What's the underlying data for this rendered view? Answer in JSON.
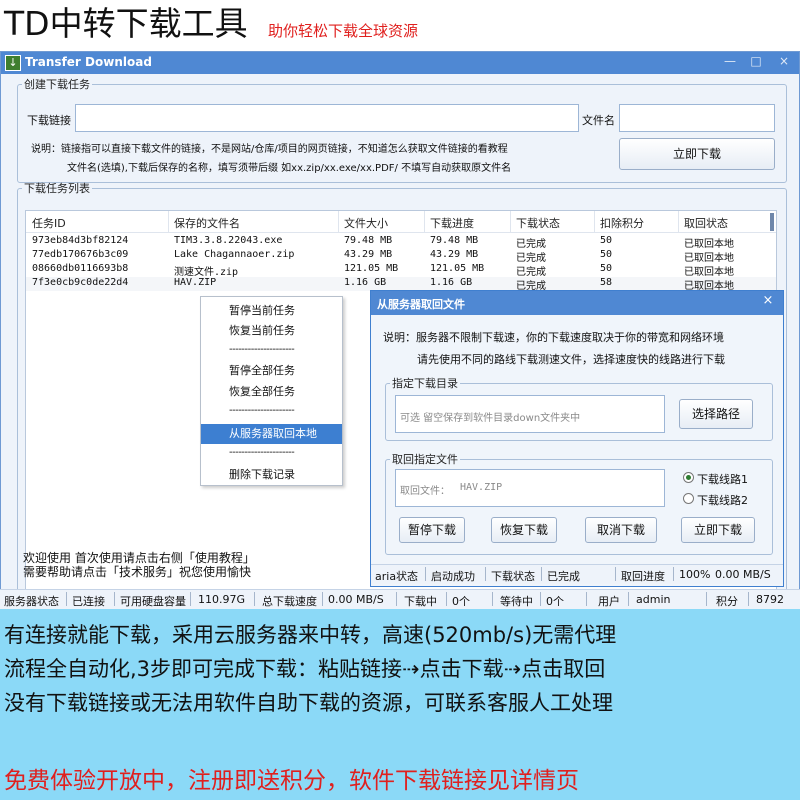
{
  "banner": {
    "title": "TD中转下载工具",
    "subtitle": "助你轻松下载全球资源"
  },
  "window": {
    "title": "Transfer Download",
    "controls": [
      "—",
      "□",
      "×"
    ]
  },
  "create_task": {
    "legend": "创建下载任务",
    "link_label": "下载链接",
    "link_value": "",
    "filename_label": "文件名",
    "filename_value": "",
    "note_line1": "说明：链接指可以直接下载文件的链接，不是网站/仓库/项目的网页链接，不知道怎么获取文件链接的看教程",
    "note_line2": "文件名(选填),下载后保存的名称，填写须带后缀 如xx.zip/xx.exe/xx.PDF/ 不填写自动获取原文件名",
    "download_button": "立即下载"
  },
  "task_list": {
    "legend": "下载任务列表",
    "columns": [
      "任务ID",
      "保存的文件名",
      "文件大小",
      "下载进度",
      "下载状态",
      "扣除积分",
      "取回状态"
    ],
    "rows": [
      [
        "973eb84d3bf82124",
        "TIM3.3.8.22043.exe",
        "79.48 MB",
        "79.48 MB",
        "已完成",
        "50",
        "已取回本地"
      ],
      [
        "77edb170676b3c09",
        "Lake Chagannaoer.zip",
        "43.29 MB",
        "43.29 MB",
        "已完成",
        "50",
        "已取回本地"
      ],
      [
        "08660db0116693b8",
        "测速文件.zip",
        "121.05 MB",
        "121.05 MB",
        "已完成",
        "50",
        "已取回本地"
      ],
      [
        "7f3e0cb9c0de22d4",
        "HAV.ZIP",
        "1.16 GB",
        "1.16 GB",
        "已完成",
        "58",
        "已取回本地"
      ]
    ],
    "welcome_line1": "欢迎使用 首次使用请点击右侧「使用教程」",
    "welcome_line2": "需要帮助请点击「技术服务」祝您使用愉快"
  },
  "context_menu": {
    "items": [
      "暂停当前任务",
      "恢复当前任务",
      "---------------------",
      "暂停全部任务",
      "恢复全部任务",
      "---------------------",
      "从服务器取回本地",
      "---------------------",
      "删除下载记录"
    ]
  },
  "dialog": {
    "title": "从服务器取回文件",
    "note_line1": "说明：服务器不限制下载速，你的下载速度取决于你的带宽和网络环境",
    "note_line2": "请先使用不同的路线下载测速文件，选择速度快的线路进行下载",
    "dir_legend": "指定下载目录",
    "dir_placeholder": "可选 留空保存到软件目录down文件夹中",
    "choose_path_button": "选择路径",
    "file_legend": "取回指定文件",
    "file_label": "取回文件：",
    "file_value": "HAV.ZIP",
    "route1": "下载线路1",
    "route2": "下载线路2",
    "buttons": [
      "暂停下载",
      "恢复下载",
      "取消下载",
      "立即下载"
    ],
    "status": {
      "aria_label": "aria状态",
      "aria_value": "启动成功",
      "dl_label": "下载状态",
      "dl_value": "已完成",
      "progress_label": "取回进度",
      "progress_value": "100%",
      "speed_value": "0.00 MB/S"
    }
  },
  "statusbar": {
    "server_label": "服务器状态",
    "server_value": "已连接",
    "disk_label": "可用硬盘容量",
    "disk_value": "110.97G",
    "speed_label": "总下载速度",
    "speed_value": "0.00 MB/S",
    "downloading_label": "下载中",
    "downloading_value": "0个",
    "waiting_label": "等待中",
    "waiting_value": "0个",
    "user_label": "用户",
    "user_value": "admin",
    "points_label": "积分",
    "points_value": "8792"
  },
  "promo": {
    "line1": "有连接就能下载，采用云服务器来中转，高速(520mb/s)无需代理",
    "line2": "流程全自动化,3步即可完成下载：粘贴链接⇢点击下载⇢点击取回",
    "line3": "没有下载链接或无法用软件自助下载的资源，可联系客服人工处理",
    "cta": "免费体验开放中，注册即送积分，软件下载链接见详情页"
  },
  "colors": {
    "titlebar": "#4f88d3",
    "window_bg": "#eef3fa",
    "promo_bg": "#8bd9f7",
    "accent_red": "#e0201e",
    "menu_selected": "#3d7fd1"
  }
}
